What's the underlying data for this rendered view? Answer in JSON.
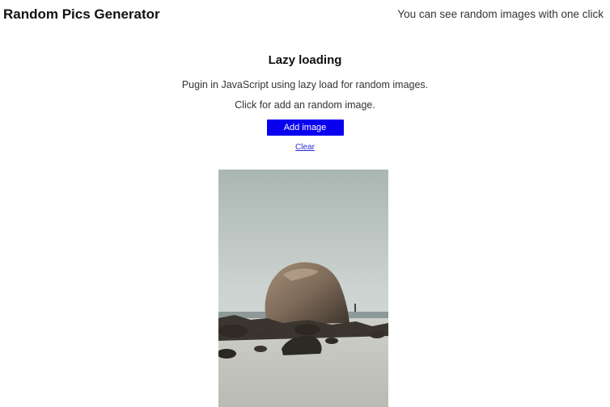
{
  "header": {
    "brand": "Random Pics Generator",
    "tagline": "You can see random images with one click"
  },
  "main": {
    "title": "Lazy loading",
    "description": "Pugin in JavaScript using lazy load for random images.",
    "hint": "Click for add an random image.",
    "add_button_label": "Add image",
    "clear_link_label": "Clear"
  },
  "colors": {
    "button_bg": "#0a00f0",
    "link": "#2a2ad8"
  },
  "images": [
    {
      "subject": "rock-on-beach-photo"
    }
  ]
}
